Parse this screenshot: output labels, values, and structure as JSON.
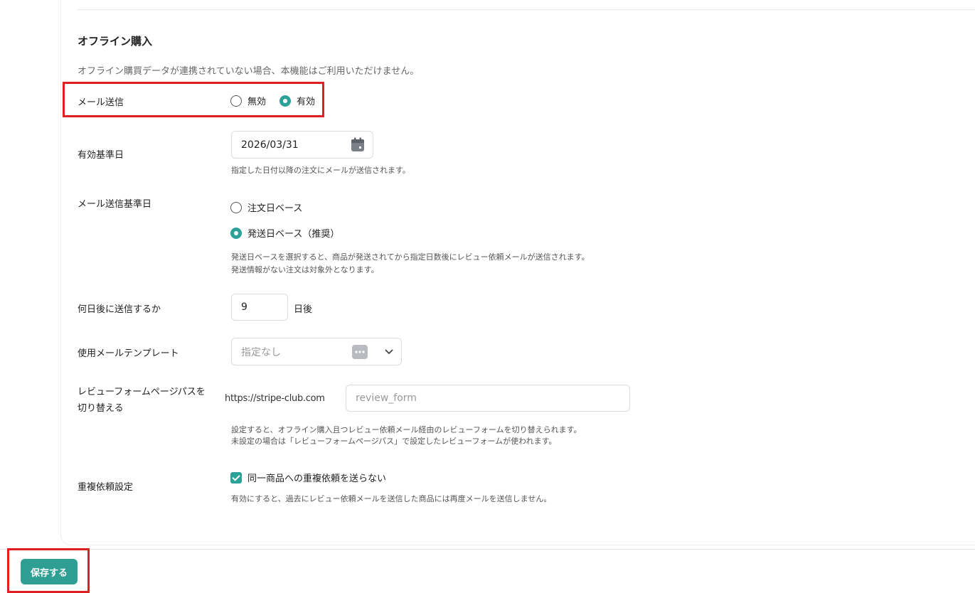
{
  "section": {
    "title": "オフライン購入",
    "description": "オフライン購買データが連携されていない場合、本機能はご利用いただけません。"
  },
  "mail_send": {
    "label": "メール送信",
    "options": [
      "無効",
      "有効"
    ],
    "selected": "有効"
  },
  "valid_date": {
    "label": "有効基準日",
    "value": "2026/03/31",
    "help": "指定した日付以降の注文にメールが送信されます。"
  },
  "send_base": {
    "label": "メール送信基準日",
    "options": [
      "注文日ベース",
      "発送日ベース（推奨）"
    ],
    "selected": "発送日ベース（推奨）",
    "help_line1": "発送日ベースを選択すると、商品が発送されてから指定日数後にレビュー依頼メールが送信されます。",
    "help_line2": "発送情報がない注文は対象外となります。"
  },
  "days_after": {
    "label": "何日後に送信するか",
    "value": "9",
    "unit": "日後"
  },
  "template": {
    "label": "使用メールテンプレート",
    "placeholder": "指定なし"
  },
  "form_path": {
    "label_line1": "レビューフォームページパスを",
    "label_line2": "切り替える",
    "prefix": "https://stripe-club.com",
    "placeholder": "review_form",
    "help_line1": "設定すると、オフライン購入且つレビュー依頼メール経由のレビューフォームを切り替えられます。",
    "help_line2": "未設定の場合は「レビューフォームページパス」で設定したレビューフォームが使われます。"
  },
  "duplicate": {
    "label": "重複依頼設定",
    "checkbox_label": "同一商品への重複依頼を送らない",
    "checked": true,
    "help": "有効にすると、過去にレビュー依頼メールを送信した商品には再度メールを送信しません。"
  },
  "save_label": "保存する",
  "colors": {
    "accent": "#2ba198",
    "highlight": "#e02020"
  }
}
